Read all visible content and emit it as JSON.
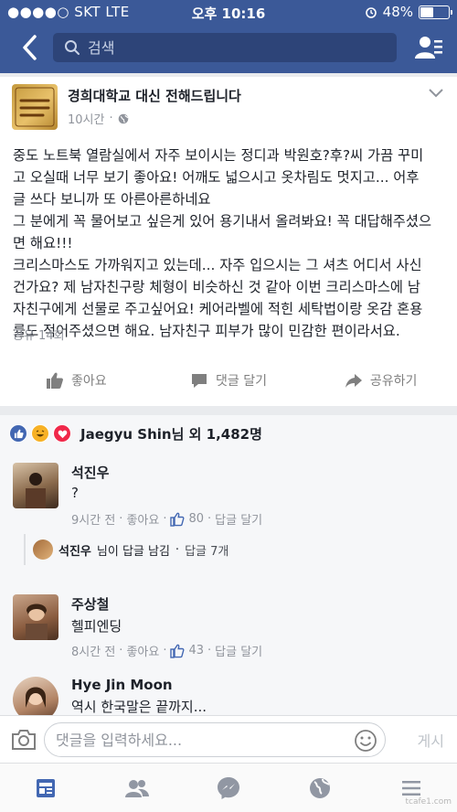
{
  "status_bar": {
    "carrier": "●●●●○ SKT  LTE",
    "time": "오후 10:16",
    "battery": "48%",
    "battery_level": 0.48
  },
  "nav": {
    "search_placeholder": "검색"
  },
  "post": {
    "page_name": "경희대학교 대신 전해드립니다",
    "time": "10시간",
    "text_lines": [
      "중도 노트북 열람실에서 자주 보이시는 정디과 박원호?후?씨 가끔 꾸미",
      "고 오실때 너무 보기 좋아요! 어깨도 넓으시고 옷차림도 멋지고... 어후",
      "글 쓰다 보니까 또 아른아른하네요",
      "그 분에게 꼭 물어보고 싶은게 있어 용기내서 올려봐요! 꼭 대답해주셨으",
      "면 해요!!!",
      "크리스마스도 가까워지고 있는데... 자주 입으시는 그 셔츠 어디서 사신",
      "건가요? 제 남자친구랑 체형이 비슷하신 것 같아 이번 크리스마스에 남",
      "자친구에게 선물로 주고싶어요! 케어라벨에 적힌 세탁법이랑 옷감 혼용",
      "률도 적어주셨으면 해요. 남자친구 피부가 많이 민감한 편이라서요."
    ],
    "shares": "공유 14회",
    "actions": {
      "like": "좋아요",
      "comment": "댓글 달기",
      "share": "공유하기"
    }
  },
  "reactions": {
    "summary_name": "Jaegyu Shin",
    "summary_rest": "님 외 1,482명"
  },
  "comments": [
    {
      "name": "석진우",
      "text": "?",
      "time": "9시간 전",
      "like_label": "좋아요",
      "like_count": "80",
      "reply_label": "답글 달기"
    },
    {
      "name": "주상철",
      "text": "헬피엔딩",
      "time": "8시간 전",
      "like_label": "좋아요",
      "like_count": "43",
      "reply_label": "답글 달기"
    },
    {
      "name": "Hye Jin Moon",
      "text": "역시 한국말은 끝까지..."
    }
  ],
  "reply_summary": {
    "name": "석진우",
    "text": "님이 답글 남김",
    "count": "답글 7개"
  },
  "composer": {
    "placeholder": "댓글을 입력하세요...",
    "post_label": "게시"
  },
  "watermark": "tcafe1.com",
  "colors": {
    "brand": "#3b5998",
    "like_blue": "#4267b2",
    "love_red": "#f0284a",
    "haha_yellow": "#f7b125"
  },
  "icons": [
    "back-icon",
    "search-icon",
    "friend-requests-icon",
    "chevron-down-icon",
    "globe-icon",
    "like-icon",
    "comment-icon",
    "share-icon",
    "camera-icon",
    "emoji-icon",
    "news-feed-icon",
    "friends-icon",
    "messenger-icon",
    "notifications-globe-icon",
    "menu-icon"
  ]
}
